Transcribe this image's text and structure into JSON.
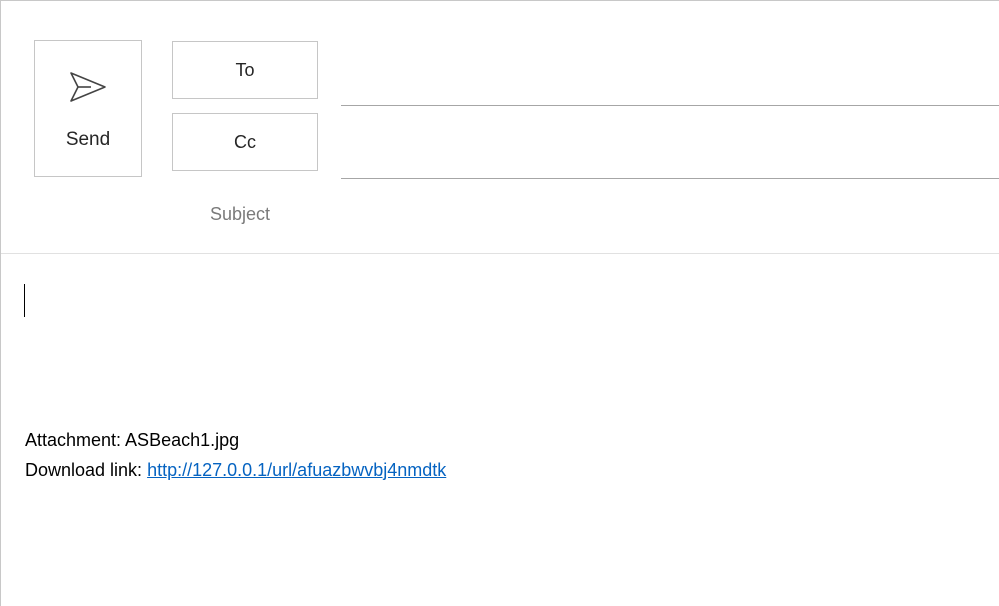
{
  "compose": {
    "send_label": "Send",
    "to_label": "To",
    "cc_label": "Cc",
    "subject_placeholder": "Subject",
    "to_value": "",
    "cc_value": "",
    "subject_value": ""
  },
  "body": {
    "attachment_text": "Attachment: ASBeach1.jpg",
    "download_prefix": "Download link:",
    "download_url": "http://127.0.0.1/url/afuazbwvbj4nmdtk"
  },
  "icons": {
    "send": "send-paper-plane-icon"
  },
  "colors": {
    "link": "#0563c1",
    "border": "#c6c6c6",
    "placeholder": "#7a7a7a"
  }
}
